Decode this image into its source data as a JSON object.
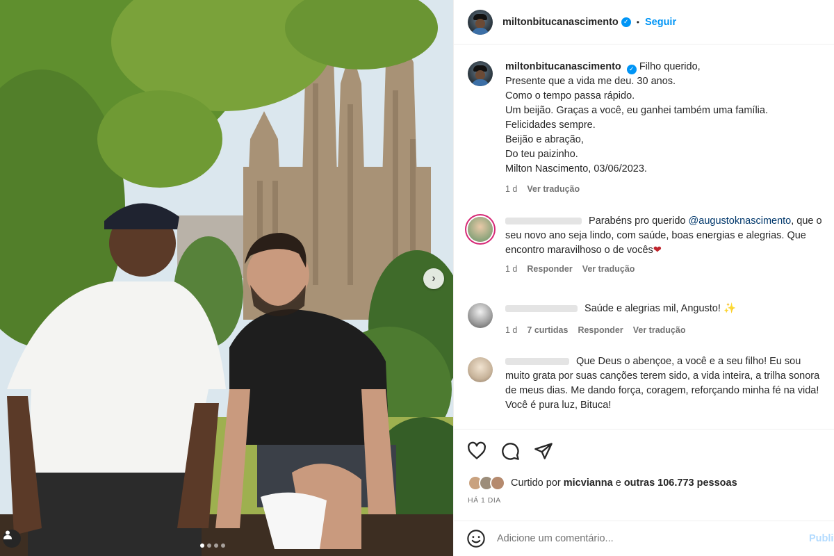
{
  "post": {
    "username": "miltonbitucanascimento",
    "follow_label": "Seguir",
    "separator": "•",
    "carousel_dots": 4,
    "carousel_active": 0
  },
  "caption": {
    "username": "miltonbitucanascimento",
    "lines": [
      "Filho querido,",
      "Presente que a vida me deu. 30 anos.",
      "Como o tempo passa rápido.",
      "Um beijão. Graças a você, eu ganhei também uma família.",
      "Felicidades sempre.",
      "Beijão e abração,",
      "Do teu paizinho.",
      "Milton Nascimento, 03/06/2023."
    ],
    "time": "1 d",
    "translate": "Ver tradução"
  },
  "comments": [
    {
      "text_before": "Parabéns pro querido ",
      "mention": "@augustoknascimento",
      "text_after": ", que o seu novo ano seja lindo, com saúde, boas energias e alegrias. Que encontro maravilhoso o de vocês",
      "emoji": "❤",
      "time": "1 d",
      "reply": "Responder",
      "translate": "Ver tradução"
    },
    {
      "text": "Saúde e alegrias mil, Angusto!",
      "emoji": "✨",
      "time": "1 d",
      "likes": "7 curtidas",
      "reply": "Responder",
      "translate": "Ver tradução"
    },
    {
      "text": "Que Deus o abençoe, a você e a seu filho! Eu sou muito grata por suas canções terem sido, a vida inteira, a trilha sonora de meus dias. Me dando força, coragem, reforçando minha fé na vida! Você é pura luz, Bituca!"
    }
  ],
  "likes": {
    "prefix": "Curtido por",
    "user": "micvianna",
    "joiner": "e",
    "others": "outras 106.773 pessoas"
  },
  "date": "HÁ 1 DIA",
  "add_comment": {
    "placeholder": "Adicione um comentário...",
    "publish": "Publicar"
  },
  "icons": {
    "like": "heart-icon",
    "comment": "comment-icon",
    "share": "send-icon",
    "emoji": "emoji-icon",
    "next": "chevron-right-icon",
    "tag": "user-tag-icon"
  },
  "colors": {
    "link": "#0095f6",
    "verified": "#0095f6",
    "muted": "#737373",
    "publish_disabled": "#b3dbff"
  }
}
